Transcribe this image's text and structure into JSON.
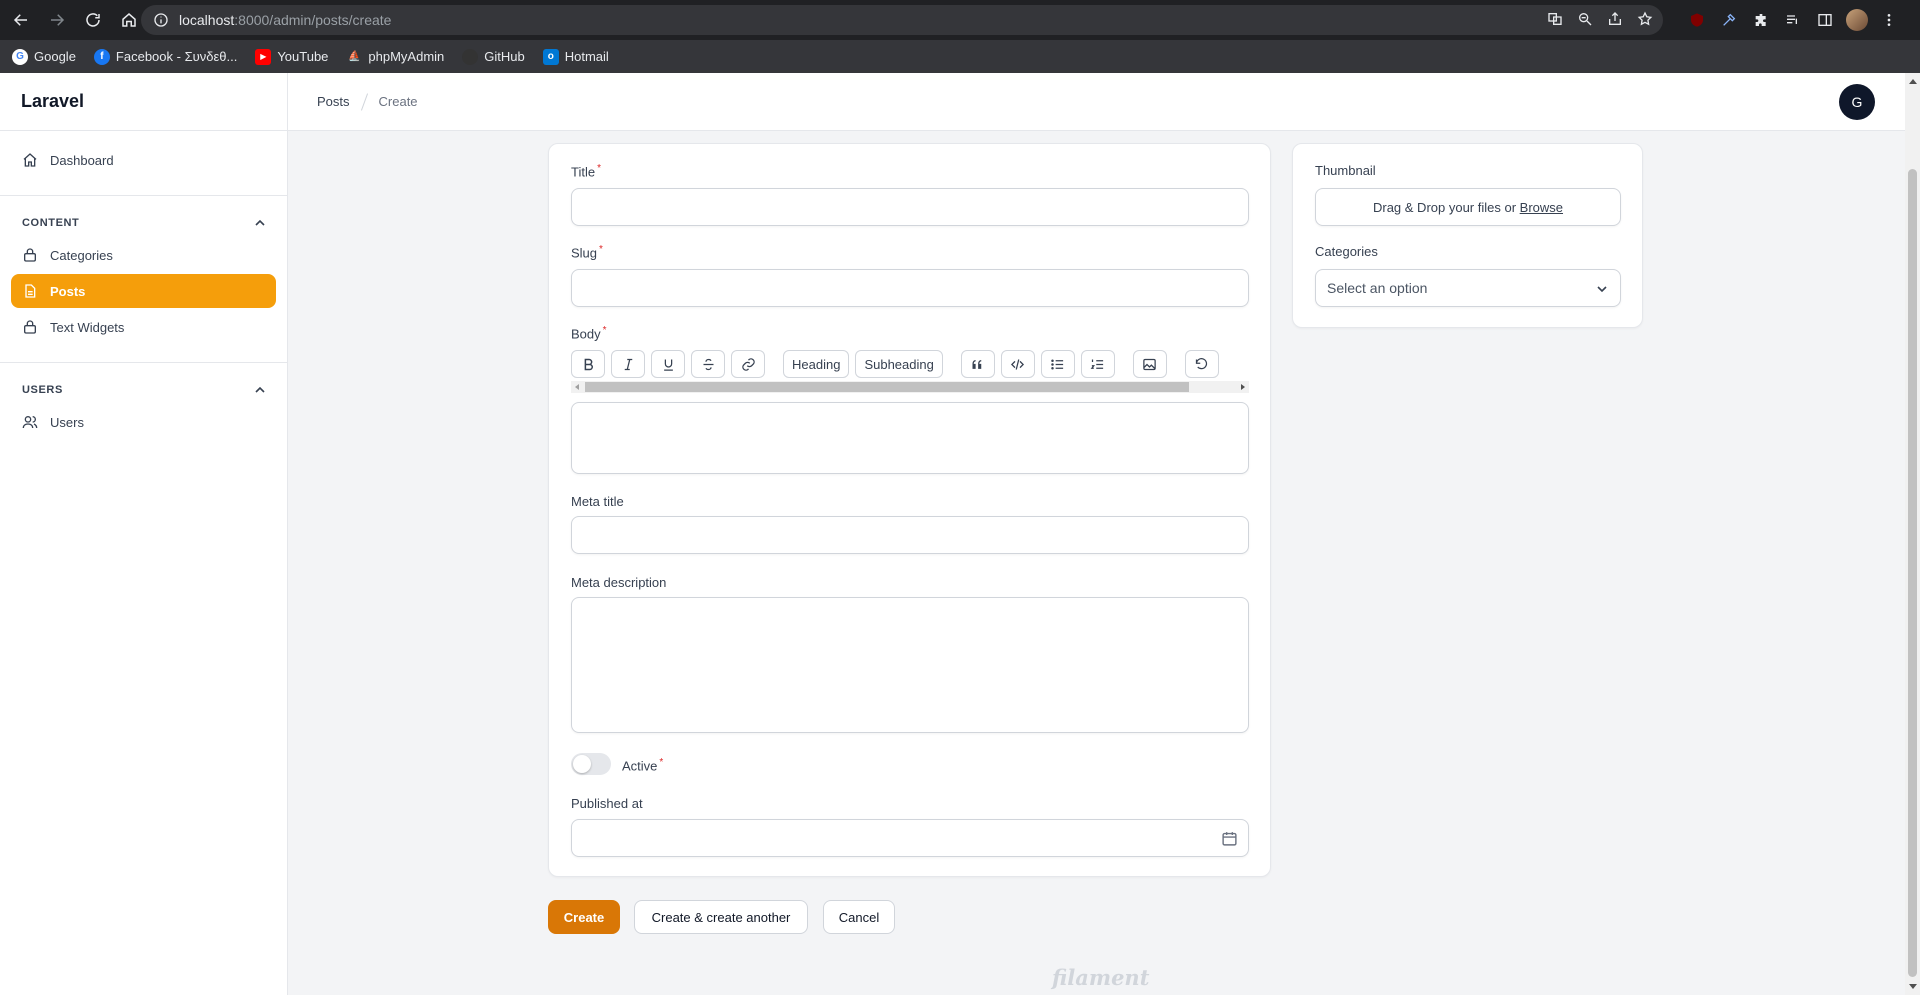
{
  "browser": {
    "url_host": "localhost",
    "url_path": ":8000/admin/posts/create",
    "bookmarks": [
      {
        "label": "Google",
        "icon": "google-icon",
        "color": "#4285f4"
      },
      {
        "label": "Facebook - Συνδεθ...",
        "icon": "facebook-icon",
        "color": "#1877f2"
      },
      {
        "label": "YouTube",
        "icon": "youtube-icon",
        "color": "#ff0000"
      },
      {
        "label": "phpMyAdmin",
        "icon": "phpmyadmin-icon",
        "color": "#f29111"
      },
      {
        "label": "GitHub",
        "icon": "github-icon",
        "color": "#333333"
      },
      {
        "label": "Hotmail",
        "icon": "outlook-icon",
        "color": "#0078d4"
      }
    ]
  },
  "sidebar": {
    "brand": "Laravel",
    "dashboard_label": "Dashboard",
    "content_group": "CONTENT",
    "content_items": [
      {
        "label": "Categories",
        "active": false
      },
      {
        "label": "Posts",
        "active": true
      },
      {
        "label": "Text Widgets",
        "active": false
      }
    ],
    "users_group": "USERS",
    "users_item": "Users",
    "accent": "#f59e0b"
  },
  "topbar": {
    "crumb_1": "Posts",
    "crumb_2": "Create",
    "avatar_initial": "G"
  },
  "form": {
    "title_label": "Title",
    "slug_label": "Slug",
    "body_label": "Body",
    "toolbar": {
      "heading": "Heading",
      "subheading": "Subheading"
    },
    "meta_title_label": "Meta title",
    "meta_description_label": "Meta description",
    "active_label": "Active",
    "active_value": false,
    "published_at_label": "Published at",
    "required_mark": "*"
  },
  "side": {
    "thumbnail_label": "Thumbnail",
    "dropzone_text": "Drag & Drop your files or ",
    "dropzone_link": "Browse",
    "categories_label": "Categories",
    "categories_placeholder": "Select an option"
  },
  "actions": {
    "create": "Create",
    "create_another": "Create & create another",
    "cancel": "Cancel"
  },
  "footer": {
    "brand": "filament"
  }
}
